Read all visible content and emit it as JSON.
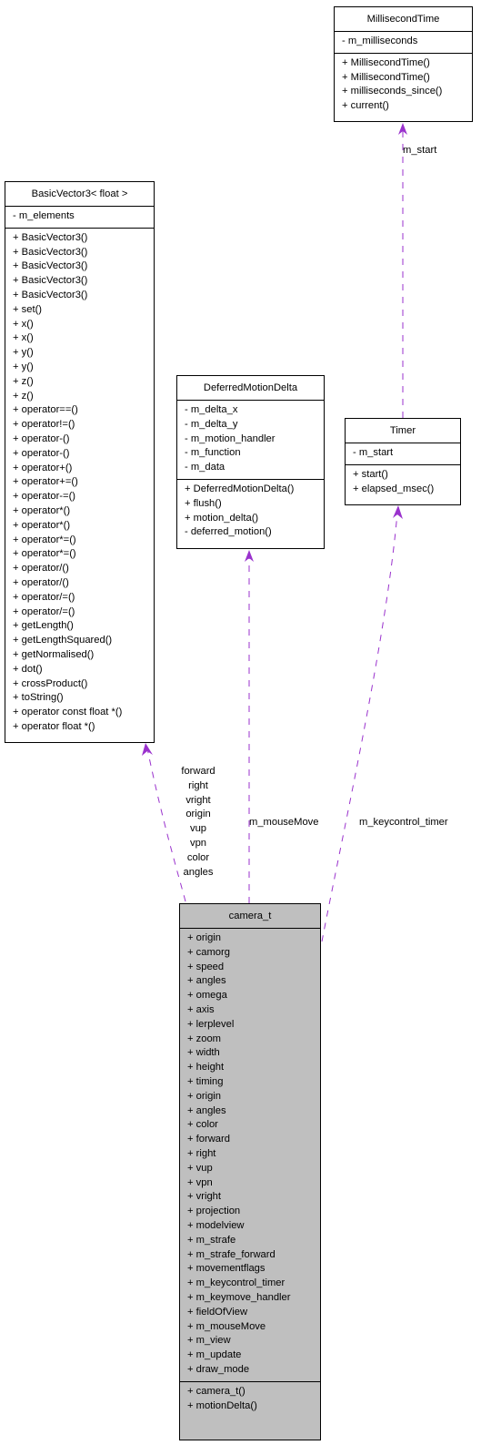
{
  "classes": {
    "millisecond_time": {
      "name": "MillisecondTime",
      "attributes": [
        "- m_milliseconds"
      ],
      "methods": [
        "+ MillisecondTime()",
        "+ MillisecondTime()",
        "+ milliseconds_since()",
        "+ current()"
      ]
    },
    "basic_vector3": {
      "name": "BasicVector3< float >",
      "attributes": [
        "- m_elements"
      ],
      "methods": [
        "+ BasicVector3()",
        "+ BasicVector3()",
        "+ BasicVector3()",
        "+ BasicVector3()",
        "+ BasicVector3()",
        "+ set()",
        "+ x()",
        "+ x()",
        "+ y()",
        "+ y()",
        "+ z()",
        "+ z()",
        "+ operator==()",
        "+ operator!=()",
        "+ operator-()",
        "+ operator-()",
        "+ operator+()",
        "+ operator+=()",
        "+ operator-=()",
        "+ operator*()",
        "+ operator*()",
        "+ operator*=()",
        "+ operator*=()",
        "+ operator/()",
        "+ operator/()",
        "+ operator/=()",
        "+ operator/=()",
        "+ getLength()",
        "+ getLengthSquared()",
        "+ getNormalised()",
        "+ dot()",
        "+ crossProduct()",
        "+ toString()",
        "+ operator const float *()",
        "+ operator float *()"
      ]
    },
    "deferred_motion_delta": {
      "name": "DeferredMotionDelta",
      "attributes": [
        "- m_delta_x",
        "- m_delta_y",
        "- m_motion_handler",
        "- m_function",
        "- m_data"
      ],
      "methods": [
        "+ DeferredMotionDelta()",
        "+ flush()",
        "+ motion_delta()",
        "- deferred_motion()"
      ]
    },
    "timer": {
      "name": "Timer",
      "attributes": [
        "- m_start"
      ],
      "methods": [
        "+ start()",
        "+ elapsed_msec()"
      ]
    },
    "camera_t": {
      "name": "camera_t",
      "attributes": [
        "+ origin",
        "+ camorg",
        "+ speed",
        "+ angles",
        "+ omega",
        "+ axis",
        "+ lerplevel",
        "+ zoom",
        "+ width",
        "+ height",
        "+ timing",
        "+ origin",
        "+ angles",
        "+ color",
        "+ forward",
        "+ right",
        "+ vup",
        "+ vpn",
        "+ vright",
        "+ projection",
        "+ modelview",
        "+ m_strafe",
        "+ m_strafe_forward",
        "+ movementflags",
        "+ m_keycontrol_timer",
        "+ m_keymove_handler",
        "+ fieldOfView",
        "+ m_mouseMove",
        "+ m_view",
        "+ m_update",
        "+ draw_mode"
      ],
      "methods": [
        "+ camera_t()",
        "+ motionDelta()"
      ]
    }
  },
  "edges": {
    "timer_to_millisecond_time": {
      "label_lines": [
        "m_start"
      ]
    },
    "camera_to_basic_vector3": {
      "label_lines": [
        "forward",
        "right",
        "vright",
        "origin",
        "vup",
        "vpn",
        "color",
        "angles"
      ]
    },
    "camera_to_deferred_motion_delta": {
      "label_lines": [
        "m_mouseMove"
      ]
    },
    "camera_to_timer": {
      "label_lines": [
        "m_keycontrol_timer"
      ]
    }
  },
  "colors": {
    "edge": "#9a32cd",
    "focus_fill": "#bfbfbf",
    "border": "#000000"
  }
}
